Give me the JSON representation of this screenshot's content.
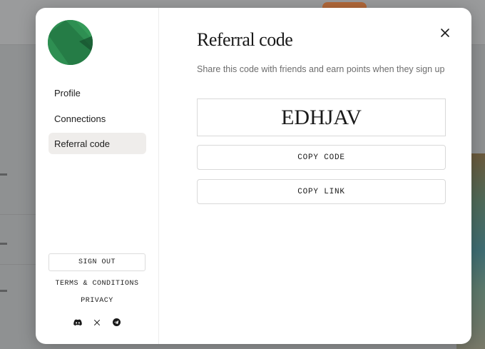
{
  "modal": {
    "title": "Referral code",
    "subtitle": "Share this code with friends and earn points when they sign up",
    "referral_code": "EDHJAV",
    "copy_code_label": "COPY CODE",
    "copy_link_label": "COPY LINK",
    "close_icon": "close-icon"
  },
  "sidebar": {
    "avatar_color": "#2e8f52",
    "items": [
      {
        "label": "Profile",
        "active": false
      },
      {
        "label": "Connections",
        "active": false
      },
      {
        "label": "Referral code",
        "active": true
      }
    ],
    "sign_out_label": "SIGN OUT",
    "terms_label": "TERMS & CONDITIONS",
    "privacy_label": "PRIVACY",
    "social_icons": [
      "discord-icon",
      "x-icon",
      "telegram-icon"
    ]
  },
  "colors": {
    "active_item_bg": "#efedeb",
    "overlay": "#8f9192"
  }
}
